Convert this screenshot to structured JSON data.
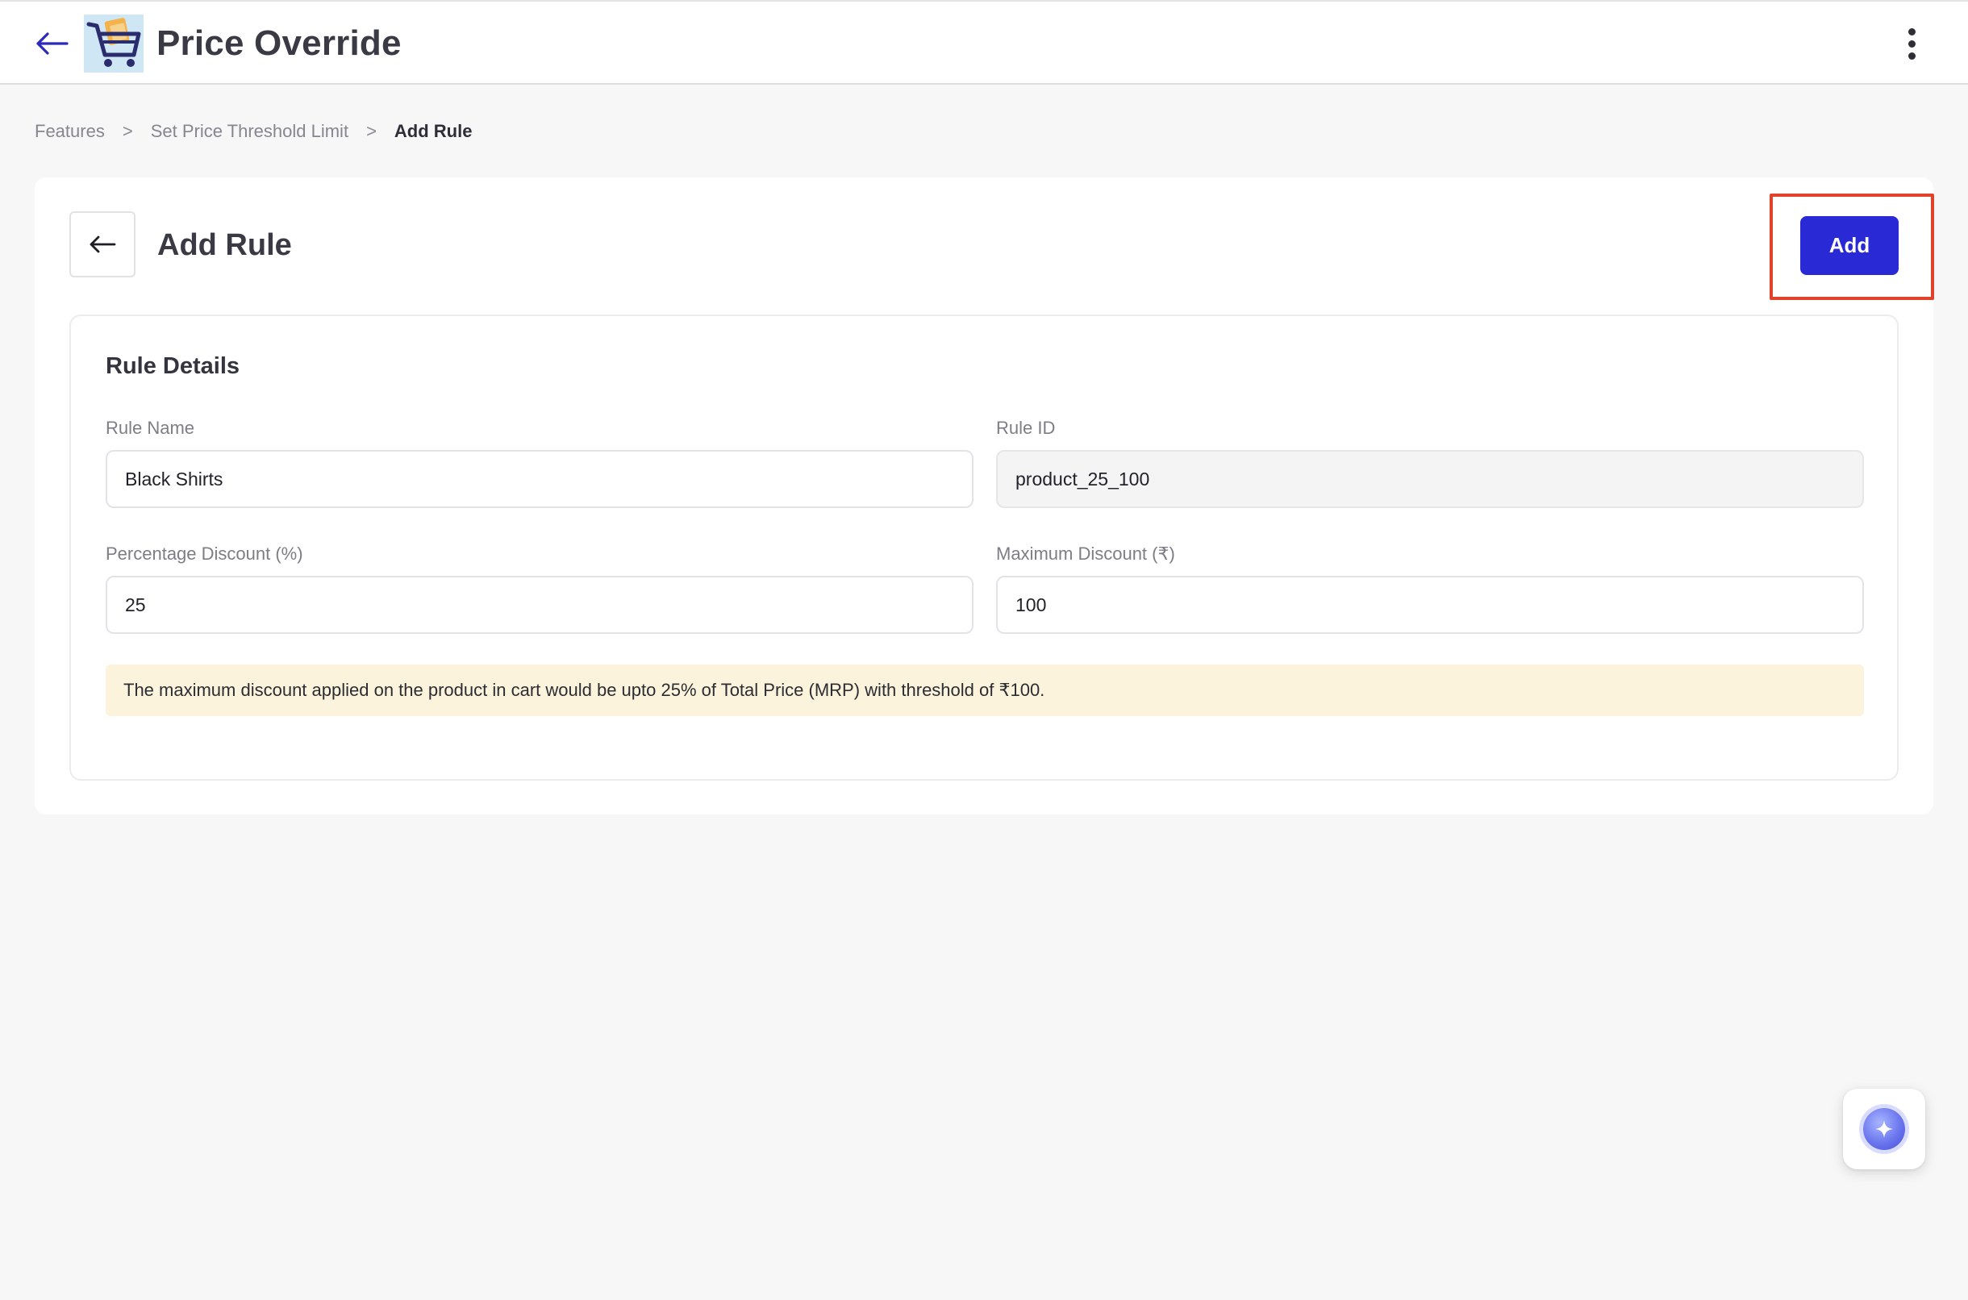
{
  "header": {
    "title": "Price Override",
    "back_icon": "arrow-left-icon",
    "logo": "shopping-cart-logo",
    "menu_icon": "more-vertical-icon"
  },
  "breadcrumb": {
    "items": [
      "Features",
      "Set Price Threshold Limit",
      "Add Rule"
    ],
    "separator": ">"
  },
  "page": {
    "heading": "Add Rule",
    "back_icon": "arrow-left-icon",
    "add_label": "Add"
  },
  "rule_details": {
    "title": "Rule Details",
    "rule_name": {
      "label": "Rule Name",
      "value": "Black Shirts"
    },
    "rule_id": {
      "label": "Rule ID",
      "value": "product_25_100"
    },
    "percentage_discount": {
      "label": "Percentage Discount (%)",
      "value": "25"
    },
    "maximum_discount": {
      "label": "Maximum Discount (₹)",
      "value": "100"
    },
    "note": "The maximum discount applied on the product in cart would be upto 25% of Total Price (MRP) with threshold of ₹100."
  },
  "assistant": {
    "icon": "sparkle-icon"
  },
  "colors": {
    "primary": "#2929d6",
    "highlight": "#e0432a",
    "note_bg": "#fcf3dc",
    "page_bg": "#f7f7f7"
  }
}
